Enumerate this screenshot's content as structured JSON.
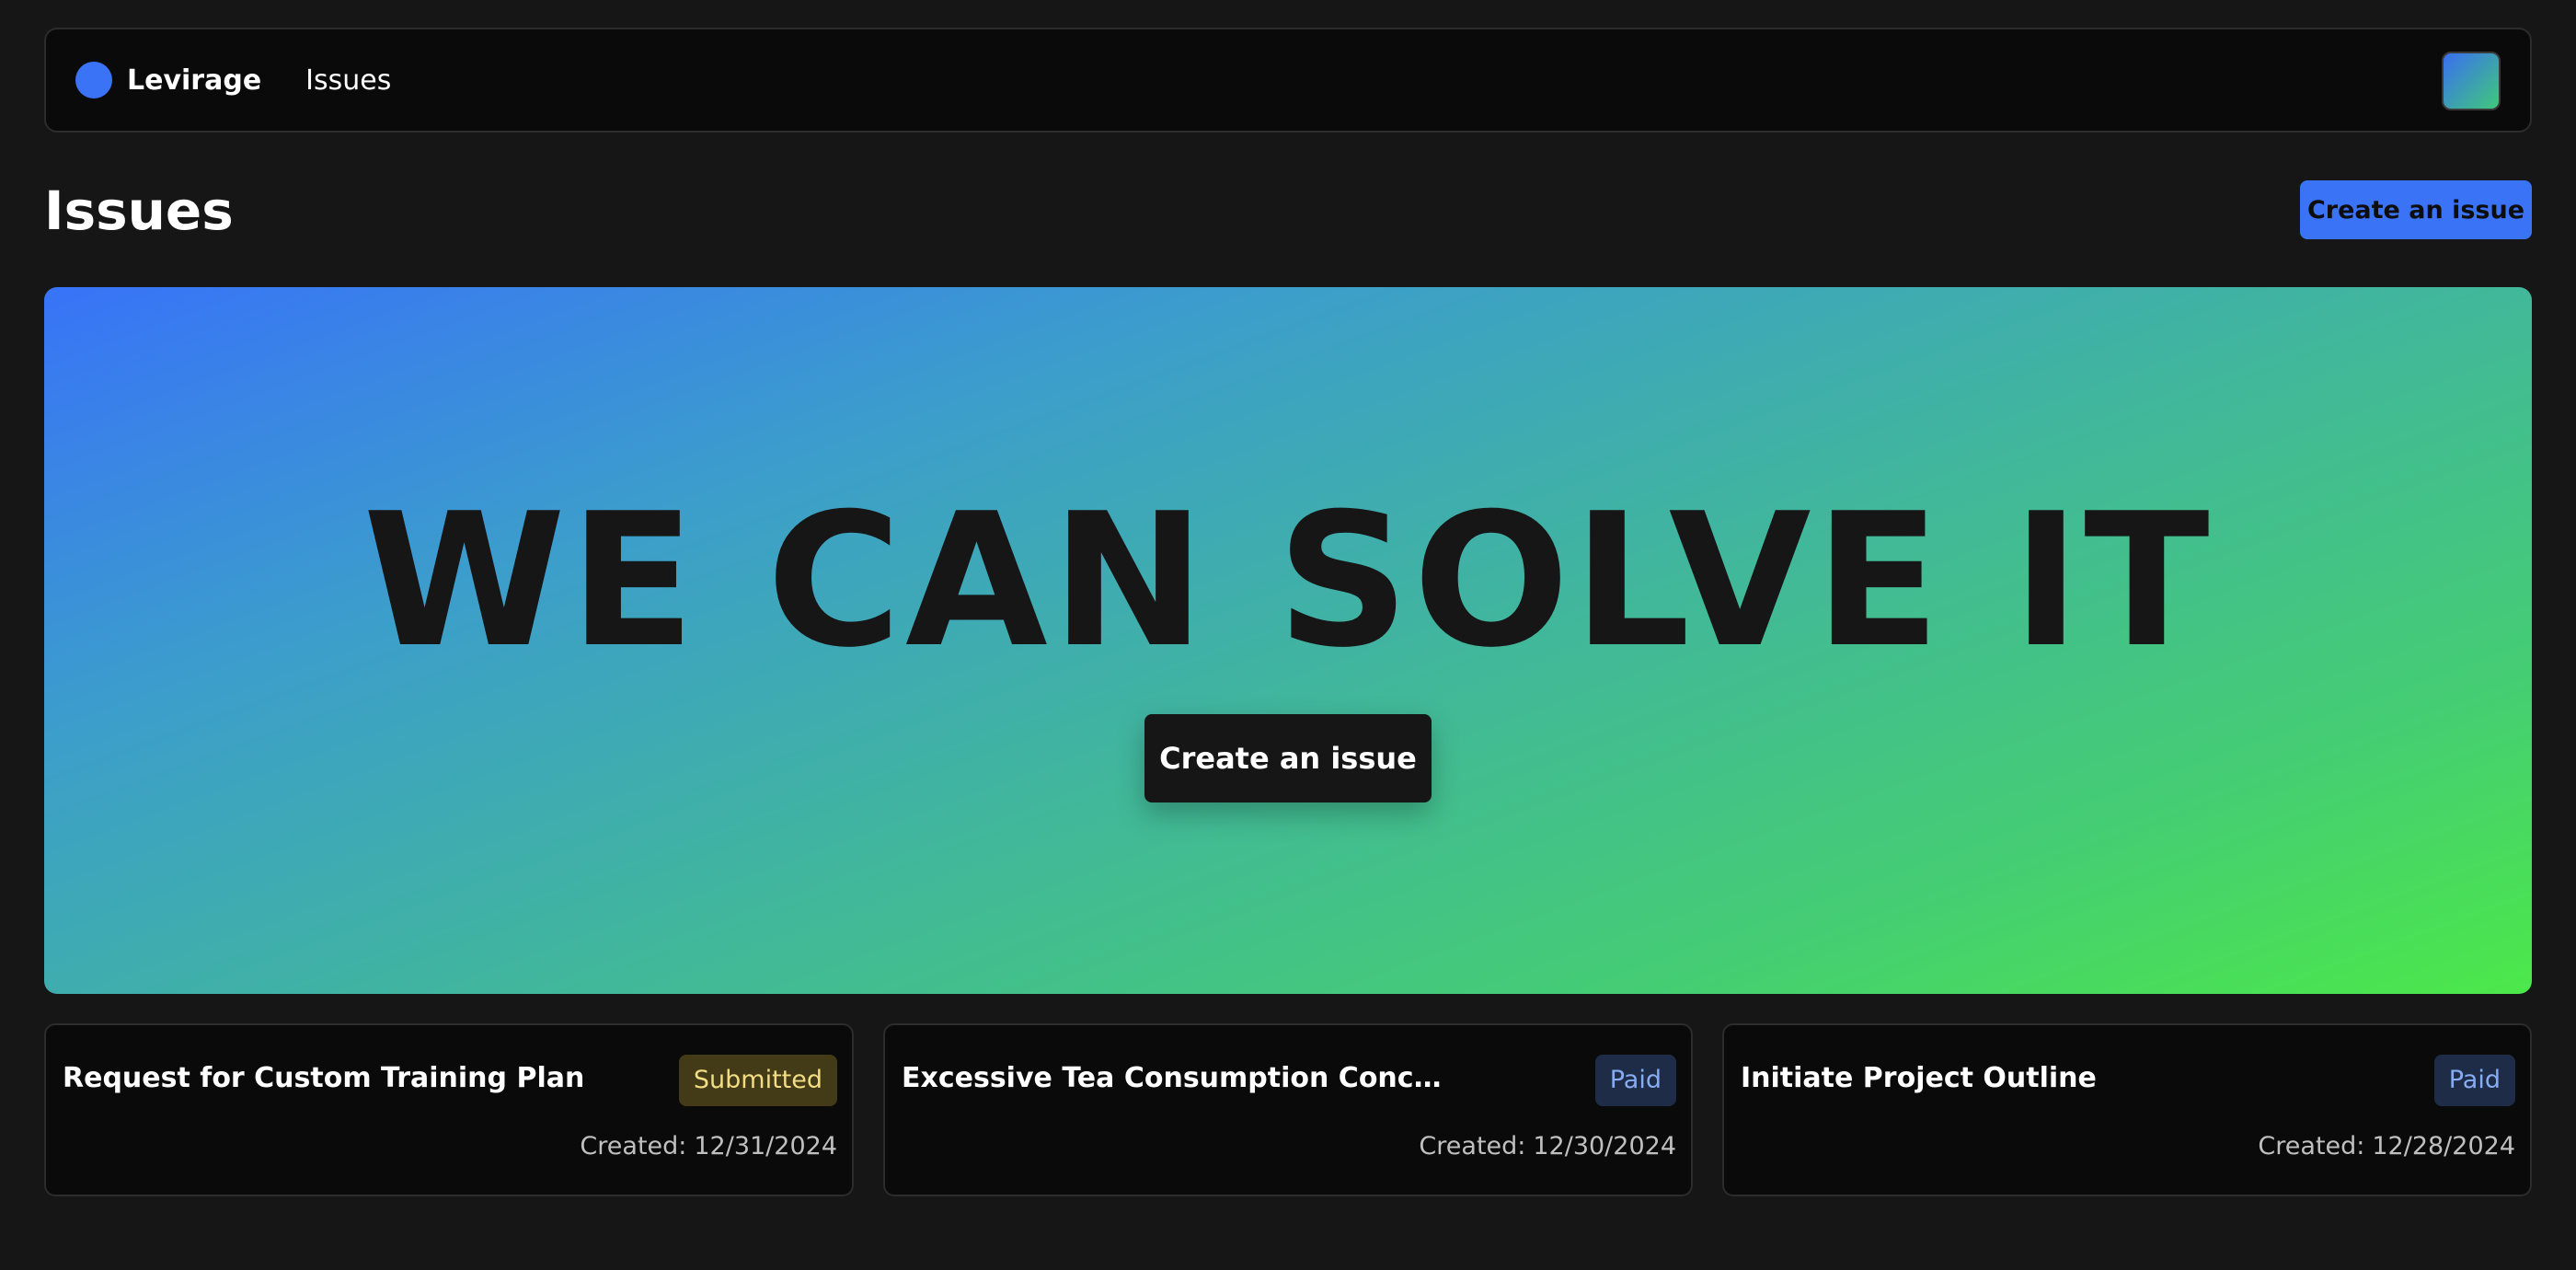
{
  "nav": {
    "brand_name": "Levirage",
    "link_issues": "Issues",
    "avatar_icon": "user-avatar-gradient"
  },
  "header": {
    "title": "Issues",
    "create_button": "Create an issue"
  },
  "hero": {
    "title": "WE CAN SOLVE IT",
    "button": "Create an issue"
  },
  "cards": [
    {
      "title": "Request for Custom Training Plan",
      "status": "Submitted",
      "created_label": "Created:",
      "created_date": "12/31/2024"
    },
    {
      "title": "Excessive Tea Consumption Conc…",
      "status": "Paid",
      "created_label": "Created:",
      "created_date": "12/30/2024"
    },
    {
      "title": "Initiate Project Outline",
      "status": "Paid",
      "created_label": "Created:",
      "created_date": "12/28/2024"
    }
  ],
  "colors": {
    "accent": "#3b73f7",
    "background": "#161616",
    "card_bg": "#0a0a0a",
    "status_submitted": "#f2dd84",
    "status_paid": "#87acf2",
    "hero_gradient_start": "#3873f8",
    "hero_gradient_end": "#4ce84a"
  }
}
